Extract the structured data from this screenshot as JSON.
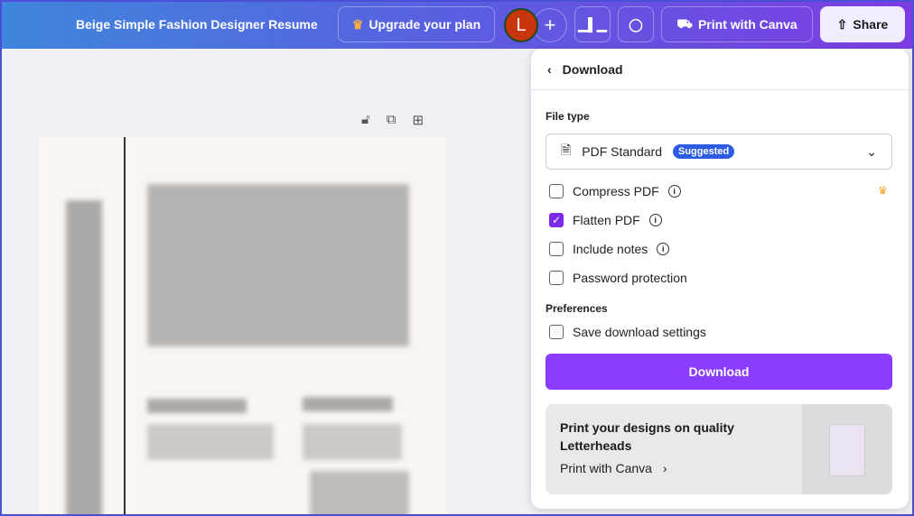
{
  "topbar": {
    "title": "Beige Simple Fashion Designer Resume",
    "upgrade": "Upgrade your plan",
    "avatar_letter": "L",
    "print": "Print with Canva",
    "share": "Share"
  },
  "panel": {
    "back_title": "Download",
    "file_type_label": "File type",
    "file_type_value": "PDF Standard",
    "suggested": "Suggested",
    "options": [
      {
        "label": "Compress PDF",
        "checked": false
      },
      {
        "label": "Flatten PDF",
        "checked": true
      },
      {
        "label": "Include notes",
        "checked": false
      },
      {
        "label": "Password protection",
        "checked": false
      }
    ],
    "preferences_label": "Preferences",
    "save_settings": "Save download settings",
    "download_button": "Download",
    "promo": {
      "title": "Print your designs on quality Letterheads",
      "link": "Print with Canva"
    }
  },
  "colors": {
    "accent": "#8b3dff",
    "badge": "#2d5be3"
  }
}
